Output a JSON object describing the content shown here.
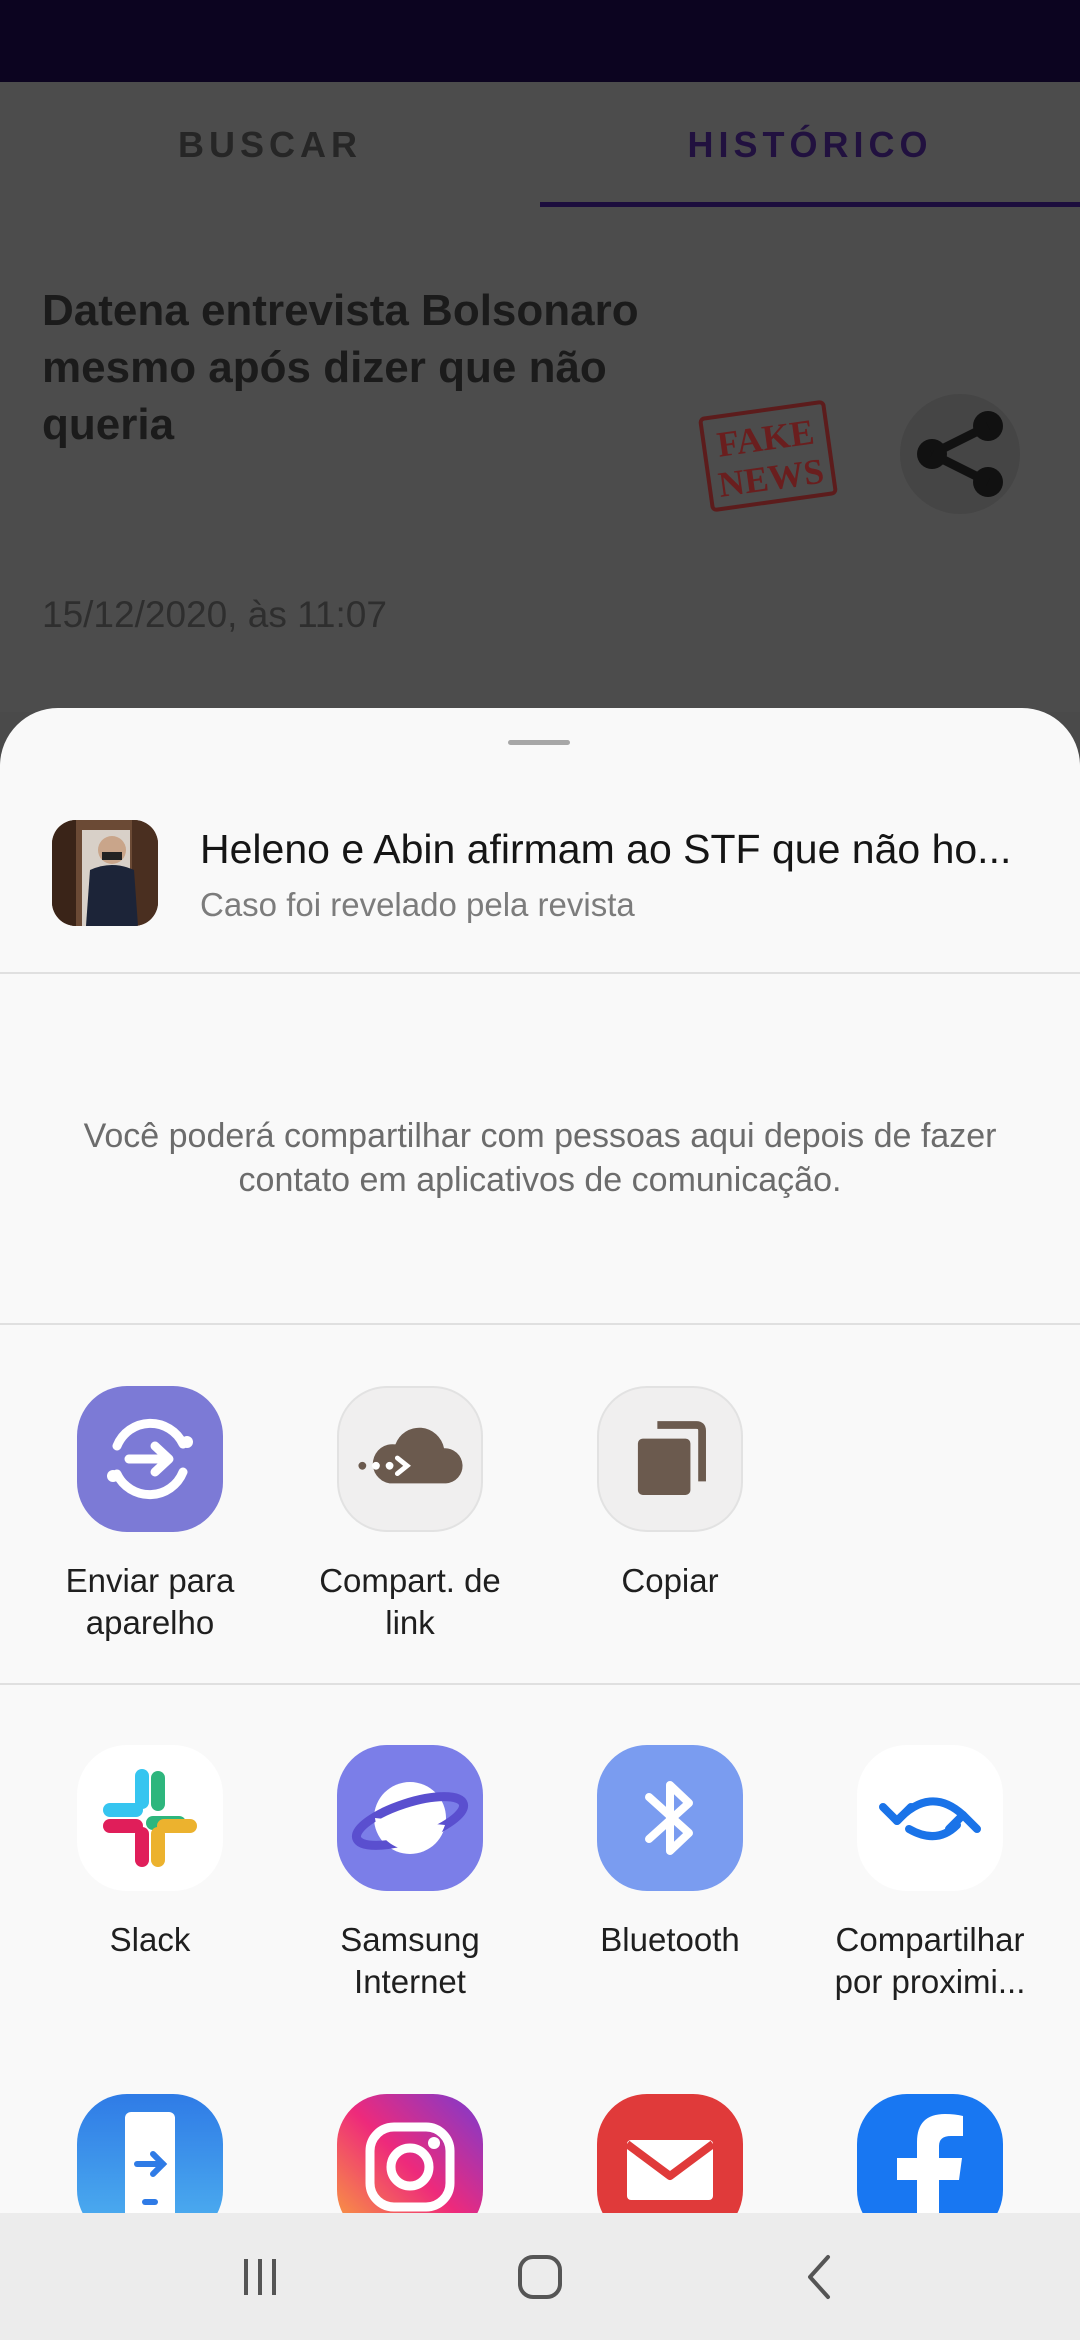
{
  "background": {
    "tabs": [
      {
        "label": "BUSCAR"
      },
      {
        "label": "HISTÓRICO"
      }
    ],
    "news": {
      "title": "Datena entrevista Bolsonaro mesmo após dizer que não queria",
      "stamp": "FAKE NEWS",
      "date": "15/12/2020, às 11:07"
    }
  },
  "sheet": {
    "preview": {
      "title": "Heleno e Abin afirmam ao STF que não ho...",
      "subtitle": "Caso foi revelado pela revista"
    },
    "info": "Você poderá compartilhar com pessoas aqui depois de fazer contato em aplicativos de comunicação.",
    "quick_actions": [
      {
        "label": "Enviar para\naparelho",
        "icon": "send-to-device-icon"
      },
      {
        "label": "Compart. de\nlink",
        "icon": "link-share-cloud-icon"
      },
      {
        "label": "Copiar",
        "icon": "copy-icon"
      }
    ],
    "apps": [
      {
        "label": "Slack",
        "icon": "slack-icon"
      },
      {
        "label": "Samsung\nInternet",
        "icon": "samsung-internet-icon"
      },
      {
        "label": "Bluetooth",
        "icon": "bluetooth-icon"
      },
      {
        "label": "Compartilhar\npor proximi...",
        "icon": "nearby-share-icon"
      }
    ],
    "apps_row2": [
      {
        "icon": "smart-switch-icon"
      },
      {
        "icon": "instagram-icon"
      },
      {
        "icon": "email-icon"
      },
      {
        "icon": "facebook-icon"
      }
    ]
  },
  "navbar": {
    "buttons": [
      "recent-apps",
      "home",
      "back"
    ]
  },
  "colors": {
    "status_bar": "#0c0420",
    "accent": "#21113f",
    "sheet_bg": "#f9f9f9",
    "samsung_purple": "#7c7ad6",
    "bluetooth_blue": "#7a9cf0",
    "email_red": "#e03a3a",
    "facebook_blue": "#1877f2"
  }
}
